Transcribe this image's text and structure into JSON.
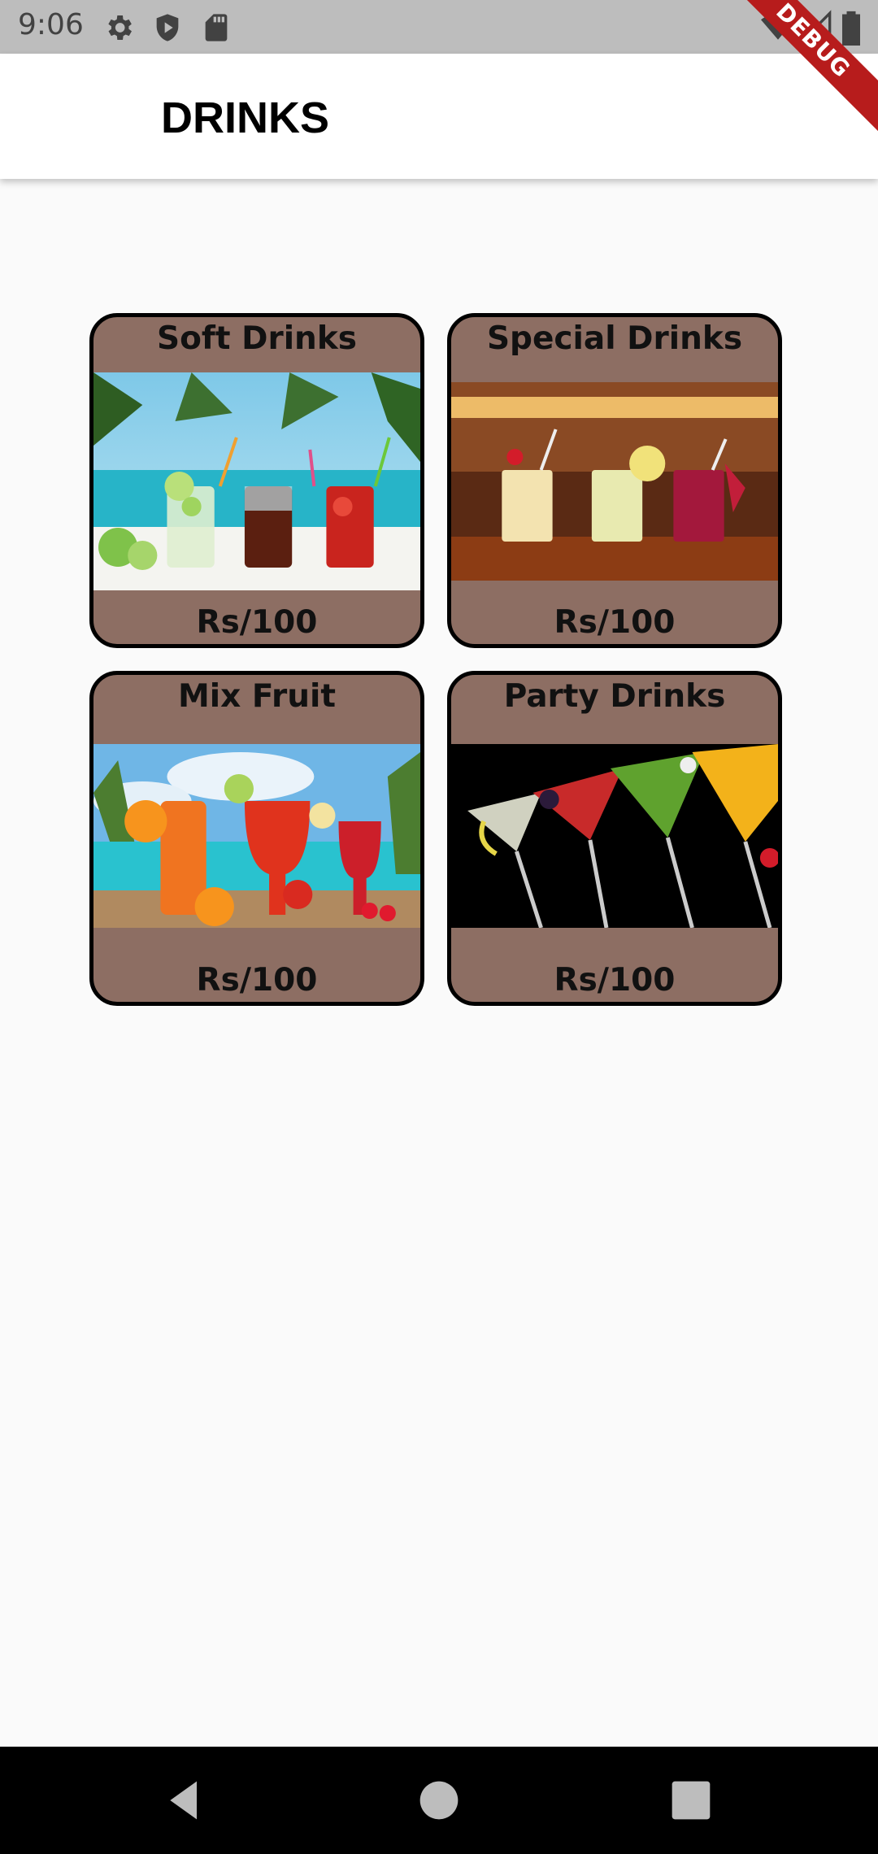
{
  "status_bar": {
    "time": "9:06",
    "icons": [
      "gear-icon",
      "shield-play-icon",
      "sd-card-icon",
      "wifi-icon",
      "signal-icon",
      "battery-icon"
    ]
  },
  "debug_banner": {
    "label": "DEBUG"
  },
  "app_bar": {
    "title": "DRINKS"
  },
  "colors": {
    "card_bg": "#8d6e63",
    "card_border": "#000000",
    "app_bar_bg": "#ffffff",
    "page_bg": "#fafafa"
  },
  "cards": [
    {
      "title": "Soft Drinks",
      "price": "Rs/100",
      "image": "soft-drinks-image"
    },
    {
      "title": "Special Drinks",
      "price": "Rs/100",
      "image": "special-drinks-image"
    },
    {
      "title": "Mix Fruit",
      "price": "Rs/100",
      "image": "mix-fruit-image"
    },
    {
      "title": "Party Drinks",
      "price": "Rs/100",
      "image": "party-drinks-image"
    }
  ],
  "nav_bar": {
    "buttons": [
      "back-icon",
      "home-icon",
      "recents-icon"
    ]
  }
}
